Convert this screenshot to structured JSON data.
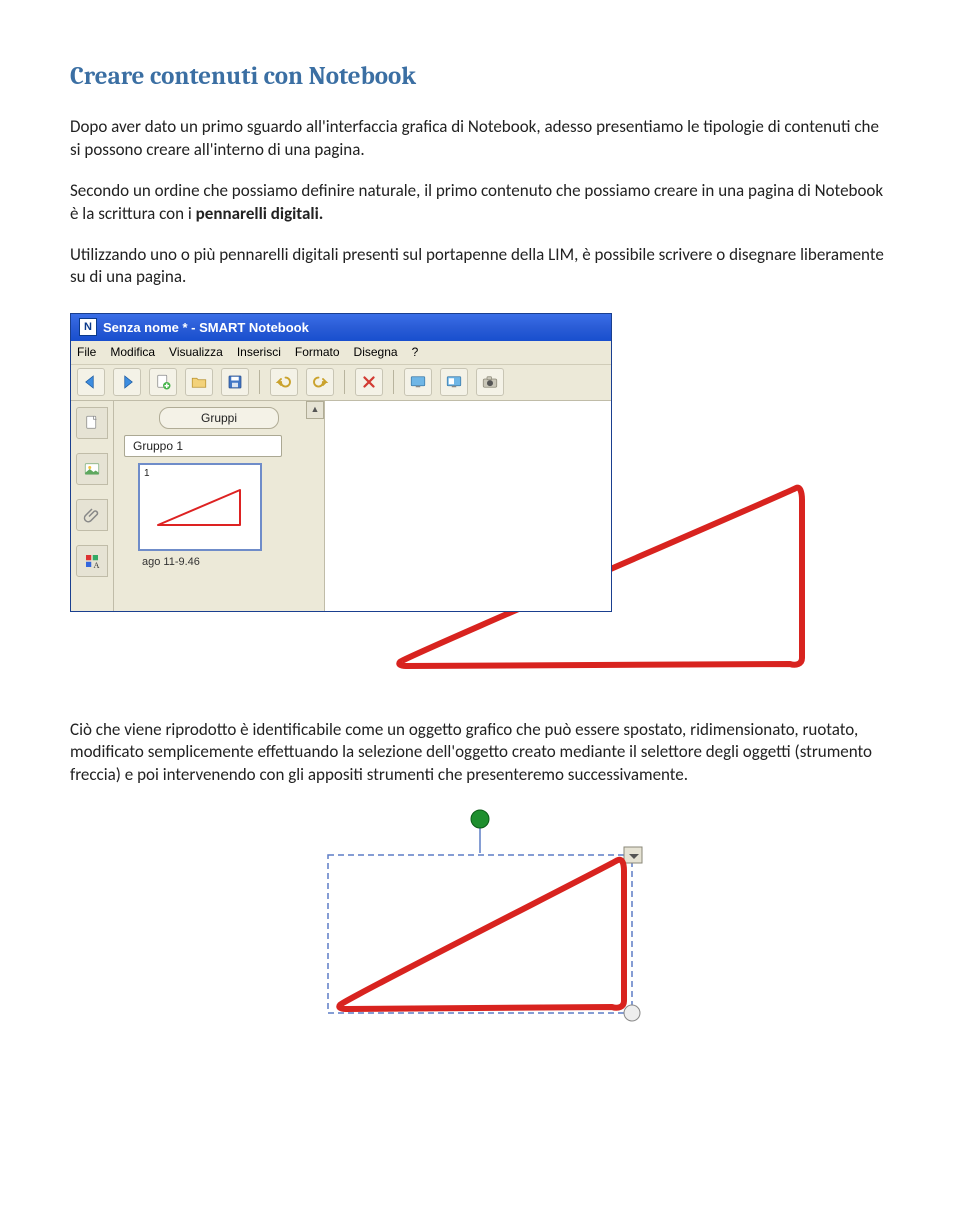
{
  "title": "Creare contenuti con Notebook",
  "para1": "Dopo aver dato un primo sguardo all'interfaccia grafica di Notebook, adesso presentiamo le tipologie di contenuti che si possono creare all'interno di una pagina.",
  "para2_a": "Secondo un ordine che possiamo definire naturale, il primo contenuto che possiamo creare in una pagina di Notebook è la scrittura con i ",
  "para2_bold": "pennarelli digitali.",
  "para3": "Utilizzando uno o più pennarelli digitali presenti sul portapenne della LIM, è possibile scrivere o disegnare liberamente su di una pagina.",
  "para4": "Ciò che viene riprodotto è identificabile come un oggetto grafico che può essere spostato, ridimensionato, ruotato, modificato semplicemente effettuando la selezione dell'oggetto creato mediante il selettore degli oggetti (strumento freccia) e poi intervenendo con gli appositi strumenti che presenteremo successivamente.",
  "app": {
    "window_title": "Senza nome * - SMART Notebook",
    "menus": [
      "File",
      "Modifica",
      "Visualizza",
      "Inserisci",
      "Formato",
      "Disegna",
      "?"
    ],
    "groups_button": "Gruppi",
    "group1_label": "Gruppo 1",
    "thumb_page_num": "1",
    "thumb_caption": "ago 11-9.46"
  }
}
